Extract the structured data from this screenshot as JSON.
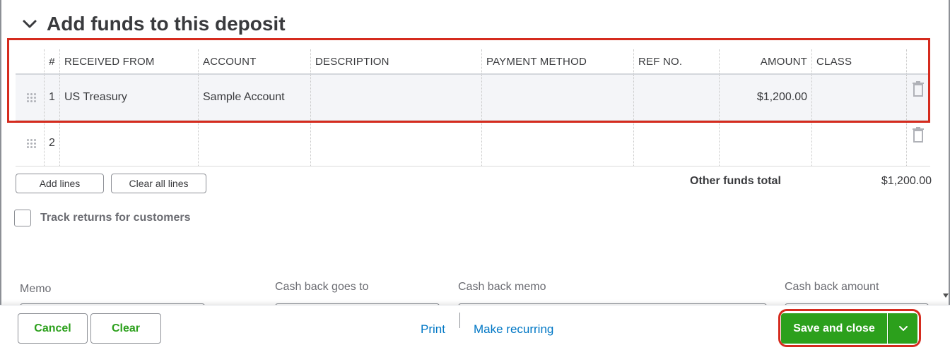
{
  "section": {
    "title": "Add funds to this deposit"
  },
  "table": {
    "headers": {
      "num": "#",
      "received_from": "RECEIVED FROM",
      "account": "ACCOUNT",
      "description": "DESCRIPTION",
      "payment_method": "PAYMENT METHOD",
      "ref_no": "REF NO.",
      "amount": "AMOUNT",
      "class": "CLASS"
    },
    "rows": [
      {
        "num": "1",
        "received_from": "US Treasury",
        "account": "Sample Account",
        "description": "",
        "payment_method": "",
        "ref_no": "",
        "amount": "$1,200.00",
        "class": ""
      },
      {
        "num": "2",
        "received_from": "",
        "account": "",
        "description": "",
        "payment_method": "",
        "ref_no": "",
        "amount": "",
        "class": ""
      }
    ]
  },
  "actions": {
    "add_lines": "Add lines",
    "clear_all_lines": "Clear all lines"
  },
  "totals": {
    "label": "Other funds total",
    "value": "$1,200.00"
  },
  "track_returns": {
    "label": "Track returns for customers",
    "checked": false
  },
  "fields": {
    "memo": "Memo",
    "cash_back_goes_to": "Cash back goes to",
    "cash_back_memo": "Cash back memo",
    "cash_back_amount": "Cash back amount"
  },
  "footer": {
    "cancel": "Cancel",
    "clear": "Clear",
    "print": "Print",
    "make_recurring": "Make recurring",
    "save_and_close": "Save and close"
  },
  "colors": {
    "brand_green": "#2ca01c",
    "link_blue": "#0077c5",
    "highlight_red": "#d52b1e"
  },
  "icons": [
    "chevron-down-icon",
    "drag-handle-icon",
    "trash-icon",
    "caret-down-icon"
  ]
}
